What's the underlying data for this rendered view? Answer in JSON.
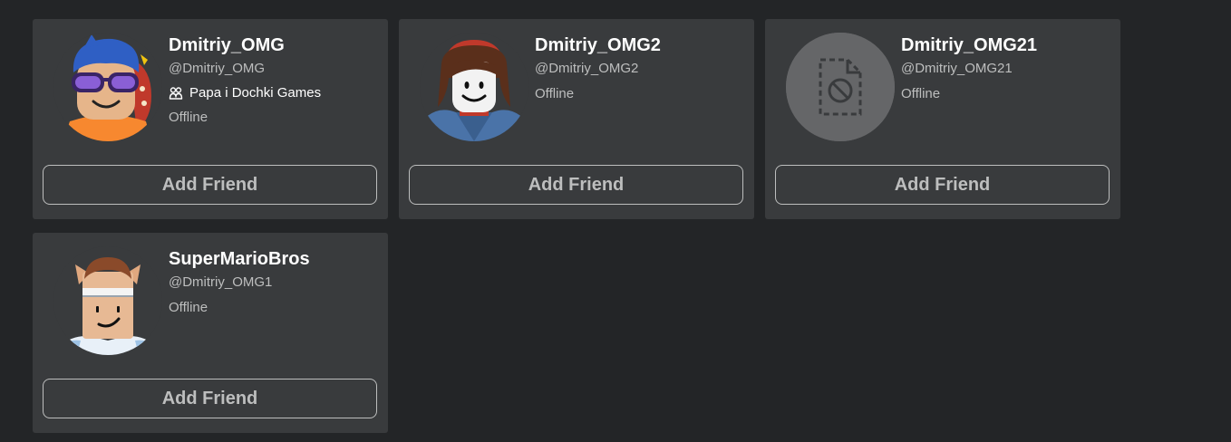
{
  "cards": [
    {
      "display_name": "Dmitriy_OMG",
      "username": "@Dmitriy_OMG",
      "group": "Papa i Dochki Games",
      "presence": "Offline",
      "button": "Add Friend"
    },
    {
      "display_name": "Dmitriy_OMG2",
      "username": "@Dmitriy_OMG2",
      "presence": "Offline",
      "button": "Add Friend"
    },
    {
      "display_name": "Dmitriy_OMG21",
      "username": "@Dmitriy_OMG21",
      "presence": "Offline",
      "button": "Add Friend"
    },
    {
      "display_name": "SuperMarioBros",
      "username": "@Dmitriy_OMG1",
      "presence": "Offline",
      "button": "Add Friend"
    }
  ],
  "icons": {
    "group": "group-icon",
    "blocked_avatar": "blocked-file-icon"
  },
  "colors": {
    "background": "#232527",
    "card": "#393b3d",
    "text_primary": "#ffffff",
    "text_secondary": "#bdbebe"
  }
}
